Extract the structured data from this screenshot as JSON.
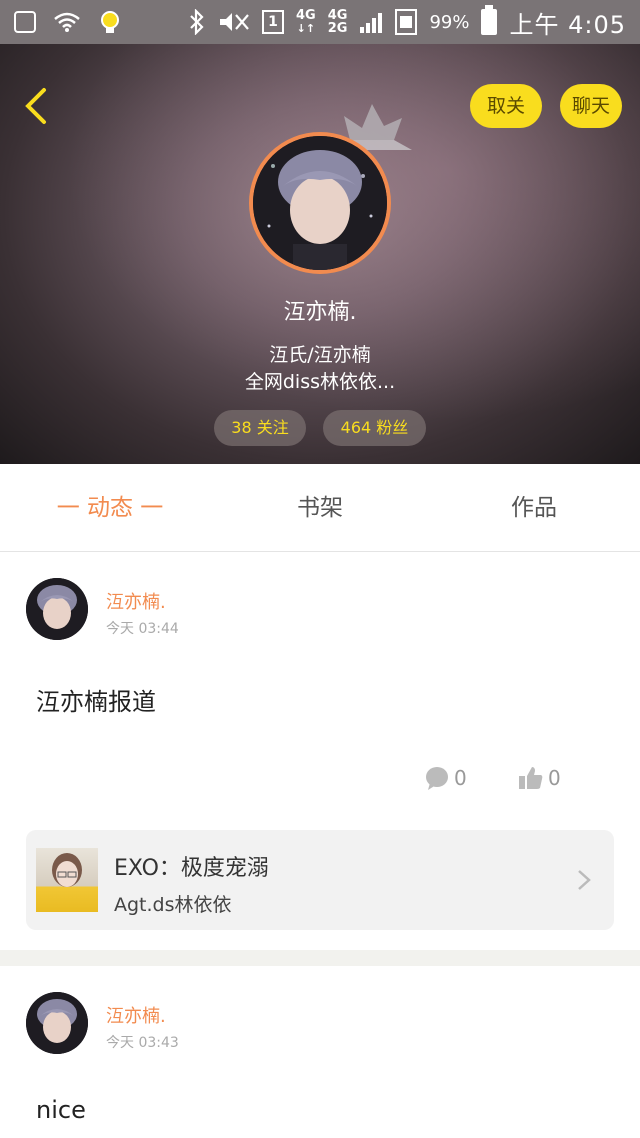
{
  "status_bar": {
    "network": [
      "4G",
      "4G",
      "2G"
    ],
    "sim": "1",
    "battery": "99%",
    "time": "上午 4:05"
  },
  "header": {
    "unfollow_label": "取关",
    "chat_label": "聊天",
    "name": "沍亦楠.",
    "bio_line1": "沍氏/沍亦楠",
    "bio_line2": "全网diss林依依...",
    "following": "38 关注",
    "followers": "464 粉丝"
  },
  "tabs": [
    {
      "label": "一 动态 一",
      "active": true
    },
    {
      "label": "书架",
      "active": false
    },
    {
      "label": "作品",
      "active": false
    }
  ],
  "posts": [
    {
      "author": "沍亦楠.",
      "time": "今天 03:44",
      "text": "沍亦楠报道",
      "comments": "0",
      "likes": "0",
      "book": {
        "title": "EXO：极度宠溺",
        "author": "Agt.ds林依依"
      }
    },
    {
      "author": "沍亦楠.",
      "time": "今天 03:43",
      "text": "nice"
    }
  ],
  "colors": {
    "accent_orange": "#f28b4f",
    "accent_yellow": "#f9dd1e",
    "divider": "#f2f2ee"
  }
}
